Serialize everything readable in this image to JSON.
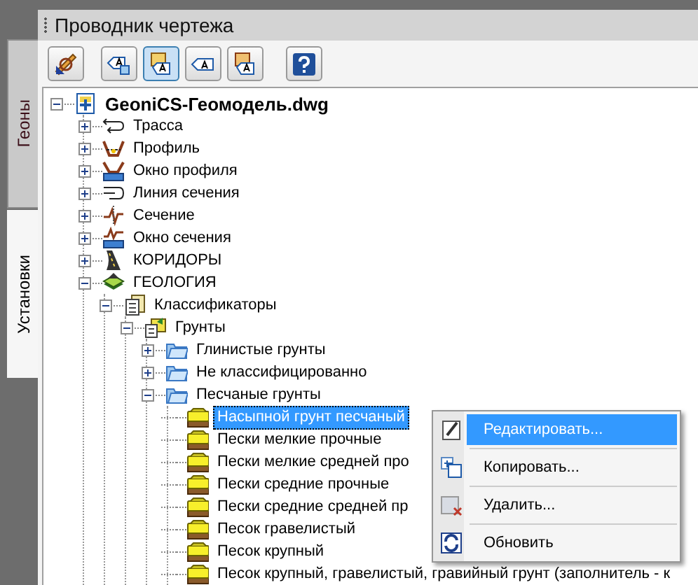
{
  "window": {
    "title": "Проводник чертежа"
  },
  "side_tabs": [
    {
      "label": "Геоны",
      "selected": false
    },
    {
      "label": "Установки",
      "selected": true
    }
  ],
  "toolbar": [
    {
      "kind": "tool",
      "pressed": false
    },
    {
      "kind": "tag-new",
      "pressed": false
    },
    {
      "kind": "tag-multi",
      "pressed": true
    },
    {
      "kind": "tag",
      "pressed": false
    },
    {
      "kind": "tag-doc",
      "pressed": false
    },
    {
      "kind": "help",
      "pressed": false
    }
  ],
  "tree": [
    {
      "label": "GeoniCS-Геомодель.dwg",
      "kind": "drawing",
      "expanded": true,
      "selected": false,
      "children": [
        {
          "label": "Трасса",
          "kind": "route",
          "expanded": false,
          "selected": false
        },
        {
          "label": "Профиль",
          "kind": "profile",
          "expanded": false,
          "selected": false
        },
        {
          "label": "Окно профиля",
          "kind": "profile-window",
          "expanded": false,
          "selected": false
        },
        {
          "label": "Линия сечения",
          "kind": "section-line",
          "expanded": false,
          "selected": false
        },
        {
          "label": "Сечение",
          "kind": "section",
          "expanded": false,
          "selected": false
        },
        {
          "label": "Окно сечения",
          "kind": "section-window",
          "expanded": false,
          "selected": false
        },
        {
          "label": "КОРИДОРЫ",
          "kind": "corridors",
          "expanded": false,
          "selected": false
        },
        {
          "label": "ГЕОЛОГИЯ",
          "kind": "geology",
          "expanded": true,
          "selected": false,
          "children": [
            {
              "label": "Классификаторы",
              "kind": "classifiers",
              "expanded": true,
              "selected": false,
              "children": [
                {
                  "label": "Грунты",
                  "kind": "soils",
                  "expanded": true,
                  "selected": false,
                  "children": [
                    {
                      "label": "Глинистые грунты",
                      "kind": "folder",
                      "expanded": false,
                      "selected": false
                    },
                    {
                      "label": "Не классифицированно",
                      "kind": "folder",
                      "expanded": false,
                      "selected": false
                    },
                    {
                      "label": "Песчаные грунты",
                      "kind": "folder",
                      "expanded": true,
                      "selected": false,
                      "children": [
                        {
                          "label": "Насыпной грунт песчаный",
                          "kind": "soil",
                          "selected": true
                        },
                        {
                          "label": "Пески мелкие прочные",
                          "kind": "soil",
                          "selected": false
                        },
                        {
                          "label": "Пески мелкие средней про",
                          "kind": "soil",
                          "selected": false
                        },
                        {
                          "label": "Пески средние прочные",
                          "kind": "soil",
                          "selected": false
                        },
                        {
                          "label": "Пески средние средней пр",
                          "kind": "soil",
                          "selected": false
                        },
                        {
                          "label": "Песок гравелистый",
                          "kind": "soil",
                          "selected": false
                        },
                        {
                          "label": "Песок крупный",
                          "kind": "soil",
                          "selected": false
                        },
                        {
                          "label": "Песок крупный, гравелистый, гравийный грунт (заполнитель - к",
                          "kind": "soil",
                          "selected": false
                        }
                      ]
                    }
                  ]
                }
              ]
            }
          ]
        }
      ]
    }
  ],
  "context_menu": [
    {
      "label": "Редактировать...",
      "kind": "edit",
      "selected": true
    },
    {
      "label": "Копировать...",
      "kind": "copy",
      "selected": false
    },
    {
      "label": "Удалить...",
      "kind": "delete",
      "selected": false
    },
    {
      "label": "Обновить",
      "kind": "refresh",
      "selected": false
    }
  ]
}
